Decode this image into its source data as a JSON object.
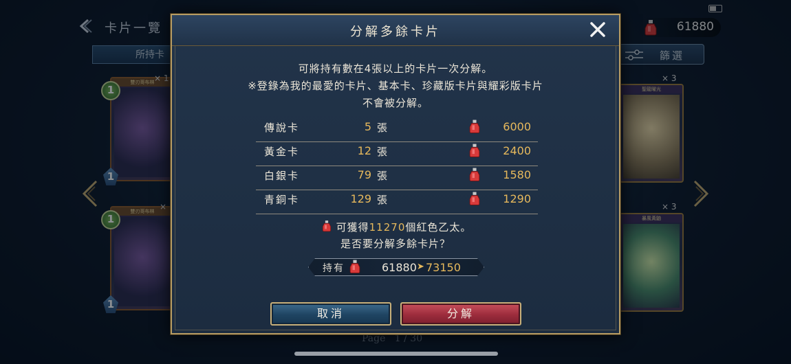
{
  "screen": {
    "title": "卡片一覽",
    "tab_owned": "所持卡",
    "filter_label": "篩選",
    "ether_balance": "61880",
    "page_word": "Page",
    "page_current": "1",
    "page_sep": "/",
    "page_total": "30",
    "cards_left": [
      {
        "name": "雙刃哥布林",
        "cost": "1",
        "atk": "1",
        "qty": "× 1"
      },
      {
        "name": "雙刃哥布林",
        "cost": "1",
        "atk": "1",
        "qty": "×"
      }
    ],
    "cards_right": [
      {
        "name": "聖龍曜光",
        "qty": "× 3"
      },
      {
        "name": "暴風黃鼬",
        "qty": "× 3"
      }
    ]
  },
  "dialog": {
    "title": "分解多餘卡片",
    "desc_line1": "可將持有數在4張以上的卡片一次分解。",
    "desc_line2": "※登錄為我的最愛的卡片、基本卡、珍藏版卡片與耀彩版卡片",
    "desc_line3": "不會被分解。",
    "rows": [
      {
        "name": "傳說卡",
        "count": "5",
        "unit": "張",
        "ether": "6000"
      },
      {
        "name": "黃金卡",
        "count": "12",
        "unit": "張",
        "ether": "2400"
      },
      {
        "name": "白銀卡",
        "count": "79",
        "unit": "張",
        "ether": "1580"
      },
      {
        "name": "青銅卡",
        "count": "129",
        "unit": "張",
        "ether": "1290"
      }
    ],
    "summary_pre": "可獲得",
    "summary_amount": "11270",
    "summary_post": "個紅色乙太。",
    "confirm_question": "是否要分解多餘卡片？",
    "owned_label": "持有",
    "owned_from": "61880",
    "owned_arrow": "➤",
    "owned_to": "73150",
    "cancel_label": "取消",
    "confirm_label": "分解"
  },
  "colors": {
    "accent_gold": "#e7b95c",
    "frame_gold": "#b79c63",
    "cancel_blue": "#1f4462",
    "confirm_red": "#9c2c3c"
  },
  "icons": {
    "ether": "red-ether-bottle-icon",
    "close": "close-icon",
    "back": "back-arrow-icon",
    "filter": "filter-sliders-icon"
  }
}
